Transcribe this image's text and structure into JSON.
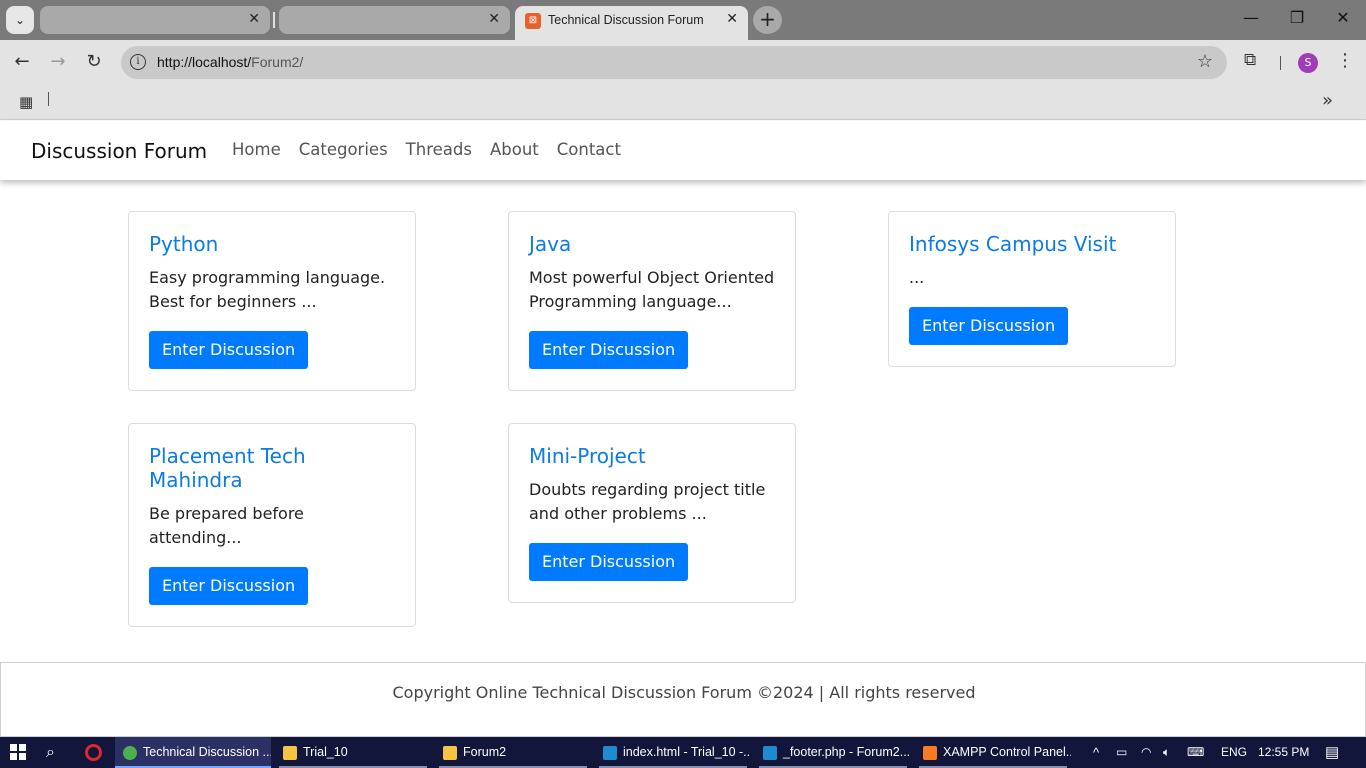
{
  "browser": {
    "active_tab_title": "Technical Discussion Forum",
    "url_host": "http://localhost/",
    "url_path": "Forum2/",
    "profile_initial": "S"
  },
  "site": {
    "brand": "Discussion Forum",
    "nav": [
      "Home",
      "Categories",
      "Threads",
      "About",
      "Contact"
    ],
    "cards": [
      {
        "title": "Python",
        "description": "Easy programming language. Best for beginners ...",
        "button": "Enter Discussion"
      },
      {
        "title": "Java",
        "description": "Most powerful Object Oriented Programming language...",
        "button": "Enter Discussion"
      },
      {
        "title": "Infosys Campus Visit",
        "description": "...",
        "button": "Enter Discussion"
      },
      {
        "title": "Placement Tech Mahindra",
        "description": "Be prepared before attending...",
        "button": "Enter Discussion"
      },
      {
        "title": "Mini-Project",
        "description": "Doubts regarding project title and other problems ...",
        "button": "Enter Discussion"
      }
    ],
    "footer": "Copyright Online Technical Discussion Forum ©2024 | All rights reserved"
  },
  "taskbar": {
    "items": [
      "Technical Discussion ...",
      "Trial_10",
      "Forum2",
      "index.html - Trial_10 -...",
      "_footer.php - Forum2...",
      "XAMPP Control Panel..."
    ],
    "language": "ENG",
    "time": "12:55 PM"
  },
  "colors": {
    "link_blue": "#0b7be6",
    "button_blue": "#007bff",
    "taskbar": "#11163a"
  }
}
